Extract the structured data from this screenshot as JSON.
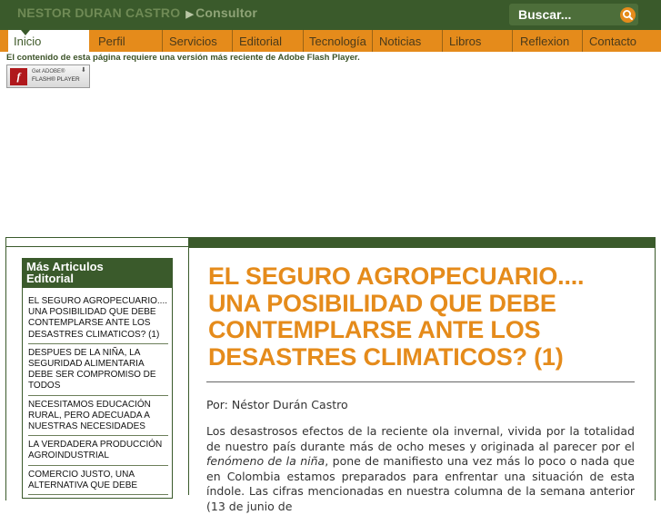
{
  "header": {
    "site_name": "NESTOR DURAN CASTRO",
    "site_role": "Consultor",
    "search_placeholder": "Buscar..."
  },
  "nav": {
    "items": [
      {
        "label": "Inicio",
        "active": true
      },
      {
        "label": "Perfil"
      },
      {
        "label": "Servicios"
      },
      {
        "label": "Editorial"
      },
      {
        "label": "Tecnología"
      },
      {
        "label": "Noticias"
      },
      {
        "label": "Libros"
      },
      {
        "label": "Reflexion"
      },
      {
        "label": "Contacto"
      }
    ]
  },
  "flash": {
    "message": "El contenido de esta página requiere una versión más reciente de Adobe Flash Player.",
    "badge_line1": "Get ADOBE®",
    "badge_line2": "FLASH® PLAYER"
  },
  "sidebar": {
    "title": "Más Articulos Editorial",
    "articles": [
      "EL SEGURO AGROPECUARIO.... UNA POSIBILIDAD QUE DEBE CONTEMPLARSE ANTE LOS DESASTRES CLIMATICOS? (1)",
      "DESPUES DE LA NIÑA, LA SEGURIDAD ALIMENTARIA DEBE SER COMPROMISO DE TODOS",
      "NECESITAMOS EDUCACIÓN RURAL, PERO ADECUADA A NUESTRAS NECESIDADES",
      "LA VERDADERA PRODUCCIÓN AGROINDUSTRIAL",
      "COMERCIO JUSTO, UNA ALTERNATIVA QUE DEBE"
    ]
  },
  "article": {
    "title": "EL SEGURO AGROPECUARIO.... UNA POSIBILIDAD QUE DEBE CONTEMPLARSE ANTE LOS DESASTRES CLIMATICOS? (1)",
    "byline": "Por: Néstor Durán Castro",
    "body_start": "Los desastrosos efectos de la reciente ola invernal, vivida por la totalidad de nuestro país durante más de ocho meses y originada al parecer por el ",
    "body_italic": "fenómeno de la niña",
    "body_end": ", pone de manifiesto una vez más  lo poco o nada que en Colombia estamos preparados para enfrentar una situación de esta índole. Las cifras mencionadas en nuestra columna de la semana anterior (13 de junio de"
  },
  "colors": {
    "brand_green": "#3a5a2b",
    "accent_orange": "#e58b1b"
  }
}
